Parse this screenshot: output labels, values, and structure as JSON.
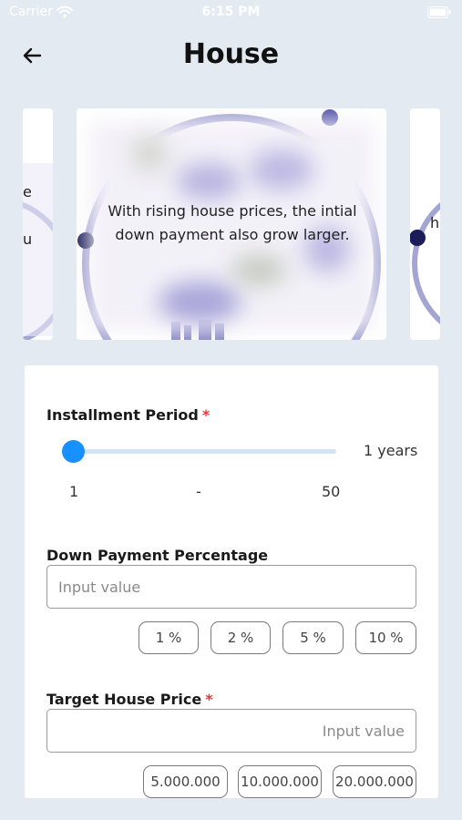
{
  "status": {
    "carrier": "Carrier",
    "time": "6:15 PM"
  },
  "header": {
    "title": "House"
  },
  "carousel": {
    "caption": "With rising house prices, the intial down payment also grow larger.",
    "left_peek_1": "e",
    "left_peek_2": "u",
    "right_peek": "h"
  },
  "form": {
    "installment": {
      "label": "Installment Period",
      "required_mark": "*",
      "value_text": "1 years",
      "min": "1",
      "separator": "-",
      "max": "50",
      "position_fraction": 0
    },
    "down_payment": {
      "label": "Down Payment Percentage",
      "placeholder": "Input value",
      "options": [
        "1 %",
        "2 %",
        "5 %",
        "10 %"
      ]
    },
    "target_price": {
      "label": "Target House Price",
      "required_mark": "*",
      "placeholder": "Input value",
      "options": [
        "5.000.000",
        "10.000.000",
        "20.000.000"
      ]
    }
  },
  "colors": {
    "background": "#e4eaf2",
    "accent": "#1890ff",
    "required": "#e53935",
    "slider_track": "#d3e3f6"
  }
}
